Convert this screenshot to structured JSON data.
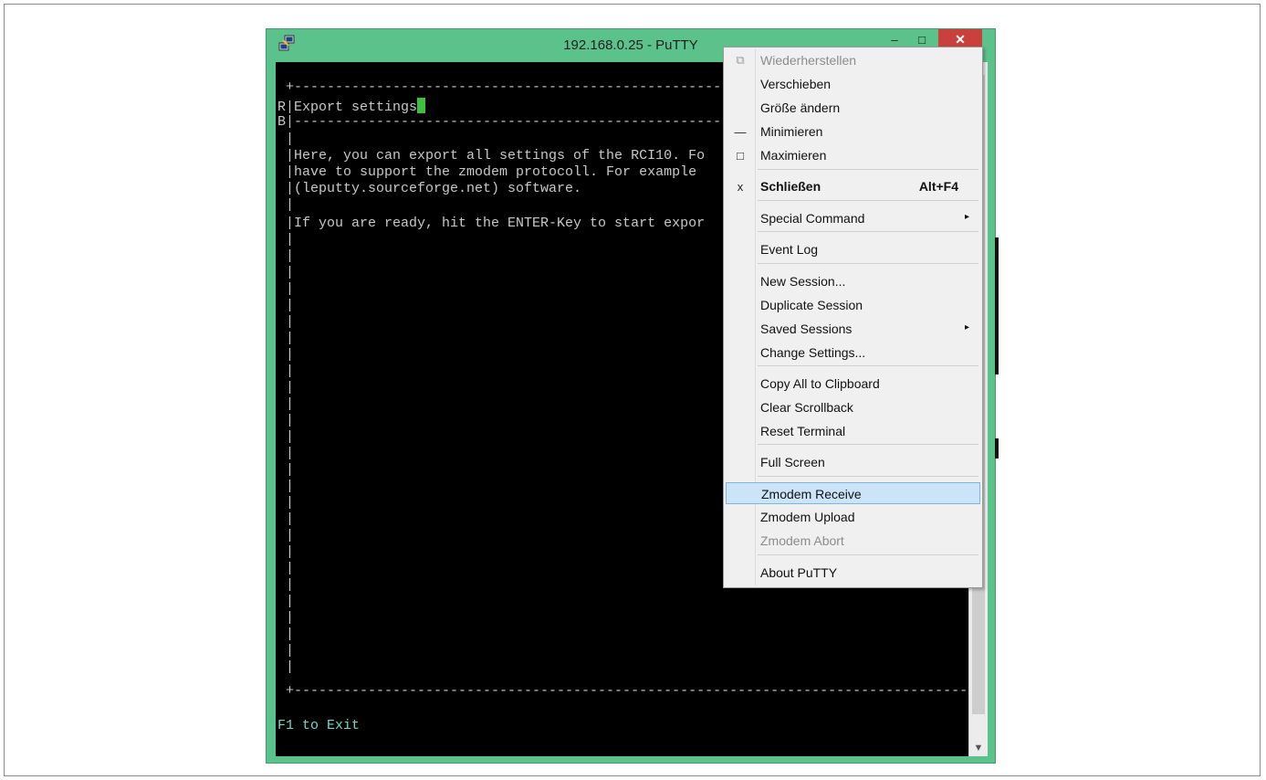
{
  "window": {
    "title": "192.168.0.25 - PuTTY",
    "minimize_symbol": "–",
    "maximize_symbol": "□",
    "close_symbol": "✕",
    "app_icon": "putty-icon",
    "accent_color": "#5cc28c",
    "close_color": "#c9403c"
  },
  "terminal": {
    "lines": [
      " +---------------------------------------------------------",
      "R|Export settings",
      "B|---------------------------------------------------------",
      " |",
      " |Here, you can export all settings of the RCI10. Fo",
      " |have to support the zmodem protocoll. For example",
      " |(leputty.sourceforge.net) software.",
      " |",
      " |If you are ready, hit the ENTER-Key to start expor",
      " |"
    ],
    "bottom_border": " +----------------------------------------------------------------------------------------------+",
    "footer": "F1 to Exit"
  },
  "menu": {
    "items": [
      {
        "label": "Wiederherstellen",
        "icon": "restore-icon",
        "icon_glyph": "⧉",
        "disabled": true
      },
      {
        "label": "Verschieben"
      },
      {
        "label": "Größe ändern"
      },
      {
        "label": "Minimieren",
        "icon": "minimize-icon",
        "icon_glyph": "—"
      },
      {
        "label": "Maximieren",
        "icon": "maximize-icon",
        "icon_glyph": "□"
      },
      {
        "label": "Schließen",
        "icon": "close-icon",
        "icon_glyph": "x",
        "accel": "Alt+F4"
      },
      {
        "label": "Special Command",
        "submenu": true
      },
      {
        "label": "Event Log"
      },
      {
        "label": "New Session..."
      },
      {
        "label": "Duplicate Session"
      },
      {
        "label": "Saved Sessions",
        "submenu": true
      },
      {
        "label": "Change Settings..."
      },
      {
        "label": "Copy All to Clipboard"
      },
      {
        "label": "Clear Scrollback"
      },
      {
        "label": "Reset Terminal"
      },
      {
        "label": "Full Screen"
      },
      {
        "label": "Zmodem Receive",
        "highlighted": true
      },
      {
        "label": "Zmodem Upload"
      },
      {
        "label": "Zmodem Abort",
        "disabled": true
      },
      {
        "label": "About PuTTY"
      }
    ],
    "submenu_arrow": "▸",
    "highlight_color": "#cce4f7"
  }
}
